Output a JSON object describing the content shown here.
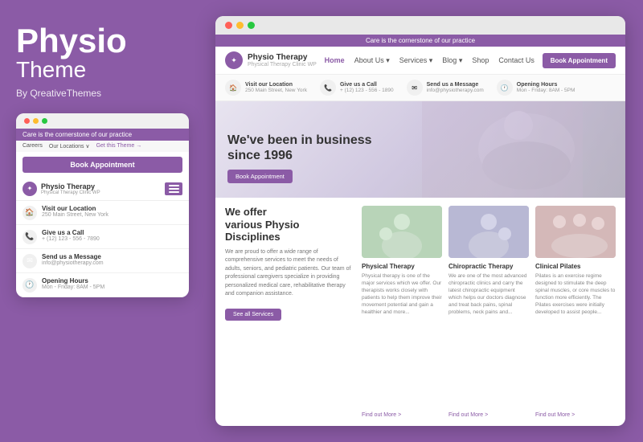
{
  "brand": {
    "physio": "Physio",
    "theme": "Theme",
    "by": "By QreativeThemes"
  },
  "mobile": {
    "notice": "Care is the cornerstone of our practice",
    "nav_careers": "Careers",
    "nav_locations": "Our Locations ∨",
    "nav_theme": "Get this Theme →",
    "book_btn": "Book Appointment",
    "logo_name": "Physio Therapy",
    "logo_sub": "Physical Therapy Clinic WP",
    "info_location_label": "Visit our Location",
    "info_location_val": "250 Main Street, New York",
    "info_call_label": "Give us a Call",
    "info_call_val": "+ (12) 123 - 556 - 7890",
    "info_message_label": "Send us a Message",
    "info_message_val": "info@physiotherapy.com",
    "info_hours_label": "Opening Hours",
    "info_hours_val": "Mon - Friday: 8AM - 5PM"
  },
  "desktop": {
    "dots": [
      "red",
      "yellow",
      "green"
    ],
    "notice": "Care is the cornerstone of our practice",
    "nav_logo_name": "Physio Therapy",
    "nav_logo_sub": "Physical Therapy Clinic WP",
    "nav_links": [
      "Home",
      "About Us",
      "Services",
      "Blog",
      "Shop",
      "Contact Us"
    ],
    "nav_book_btn": "Book Appointment",
    "info_location_label": "Visit our Location",
    "info_location_val": "250 Main Street, New York",
    "info_call_label": "Give us a Call",
    "info_call_val": "+ (12) 123 - 556 - 1890",
    "info_message_label": "Send us a Message",
    "info_message_val": "info@physiotherapy.com",
    "info_hours_label": "Opening Hours",
    "info_hours_val": "Mon - Friday: 8AM - 5PM",
    "hero_text_1": "We've been in business",
    "hero_text_2": "since 1996",
    "hero_btn": "Book Appointment",
    "offer_title_1": "We offer",
    "offer_title_2": "various Physio",
    "offer_title_3": "Disciplines",
    "offer_text": "We are proud to offer a wide range of comprehensive services to meet the needs of adults, seniors, and pediatric patients. Our team of professional caregivers specialize in providing personalized medical care, rehabilitative therapy and companion assistance.",
    "see_btn": "See all Services",
    "card1_name": "Physical Therapy",
    "card1_desc": "Physical therapy is one of the major services which we offer. Our therapists works closely with patients to help them improve their movement potential and gain a healthier and more...",
    "card1_link": "Find out More >",
    "card2_name": "Chiropractic Therapy",
    "card2_desc": "We are one of the most advanced chiropractic clinics and carry the latest chiropractic equipment which helps our doctors diagnose and treat back pains, spinal problems, neck pains and...",
    "card2_link": "Find out More >",
    "card3_name": "Clinical Pilates",
    "card3_desc": "Pilates is an exercise regime designed to stimulate the deep spinal muscles, or core muscles to function more efficiently. The Pilates exercises were initially developed to assist people...",
    "card3_link": "Find out More >"
  },
  "colors": {
    "purple": "#8B5BA6",
    "light_purple": "#a06cc0"
  }
}
